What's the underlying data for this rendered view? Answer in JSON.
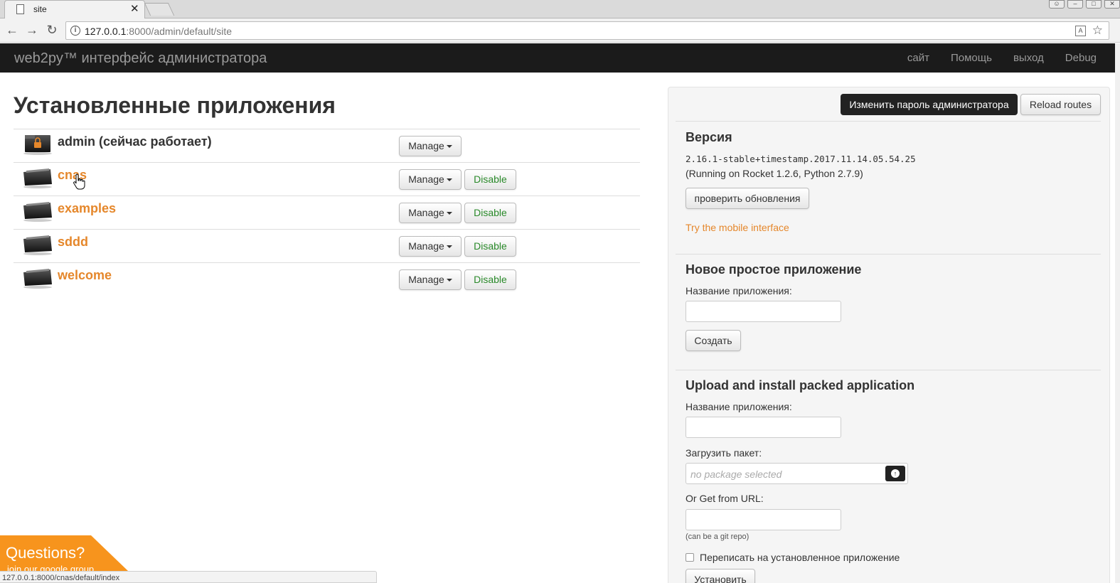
{
  "browser": {
    "tab_title": "site",
    "tab_close": "✕",
    "url_host": "127.0.0.1",
    "url_rest": ":8000/admin/default/site",
    "status_url": "127.0.0.1:8000/cnas/default/index"
  },
  "navbar": {
    "brand": "web2py™ интерфейс администратора",
    "links": [
      "сайт",
      "Помощь",
      "выход",
      "Debug"
    ]
  },
  "main": {
    "title": "Установленные приложения",
    "apps": [
      {
        "name": "admin (сейчас работает)",
        "manage": "Manage",
        "disable": ""
      },
      {
        "name": "cnas",
        "manage": "Manage",
        "disable": "Disable"
      },
      {
        "name": "examples",
        "manage": "Manage",
        "disable": "Disable"
      },
      {
        "name": "sddd",
        "manage": "Manage",
        "disable": "Disable"
      },
      {
        "name": "welcome",
        "manage": "Manage",
        "disable": "Disable"
      }
    ]
  },
  "sidebar": {
    "change_password": "Изменить пароль администратора",
    "reload_routes": "Reload routes",
    "version_heading": "Версия",
    "version": "2.16.1-stable+timestamp.2017.11.14.05.54.25",
    "running_on": "(Running on Rocket 1.2.6, Python 2.7.9)",
    "check_updates": "проверить обновления",
    "mobile_link": "Try the mobile interface",
    "new_app_heading": "Новое простое приложение",
    "app_name_label": "Название приложения:",
    "create_button": "Создать",
    "upload_heading": "Upload and install packed application",
    "upload_app_name_label": "Название приложения:",
    "package_label": "Загрузить пакет:",
    "package_placeholder": "no package selected",
    "url_label": "Or Get from URL:",
    "git_hint": "(can be a git repo)",
    "overwrite_label": "Переписать на установленное приложение",
    "install_button": "Установить"
  },
  "badge": {
    "title": "Questions?",
    "subtitle": "join our google group"
  },
  "colors": {
    "accent": "#e5872b",
    "navbar_bg": "#1b1b1b",
    "disable_text": "#2a8a2a"
  }
}
